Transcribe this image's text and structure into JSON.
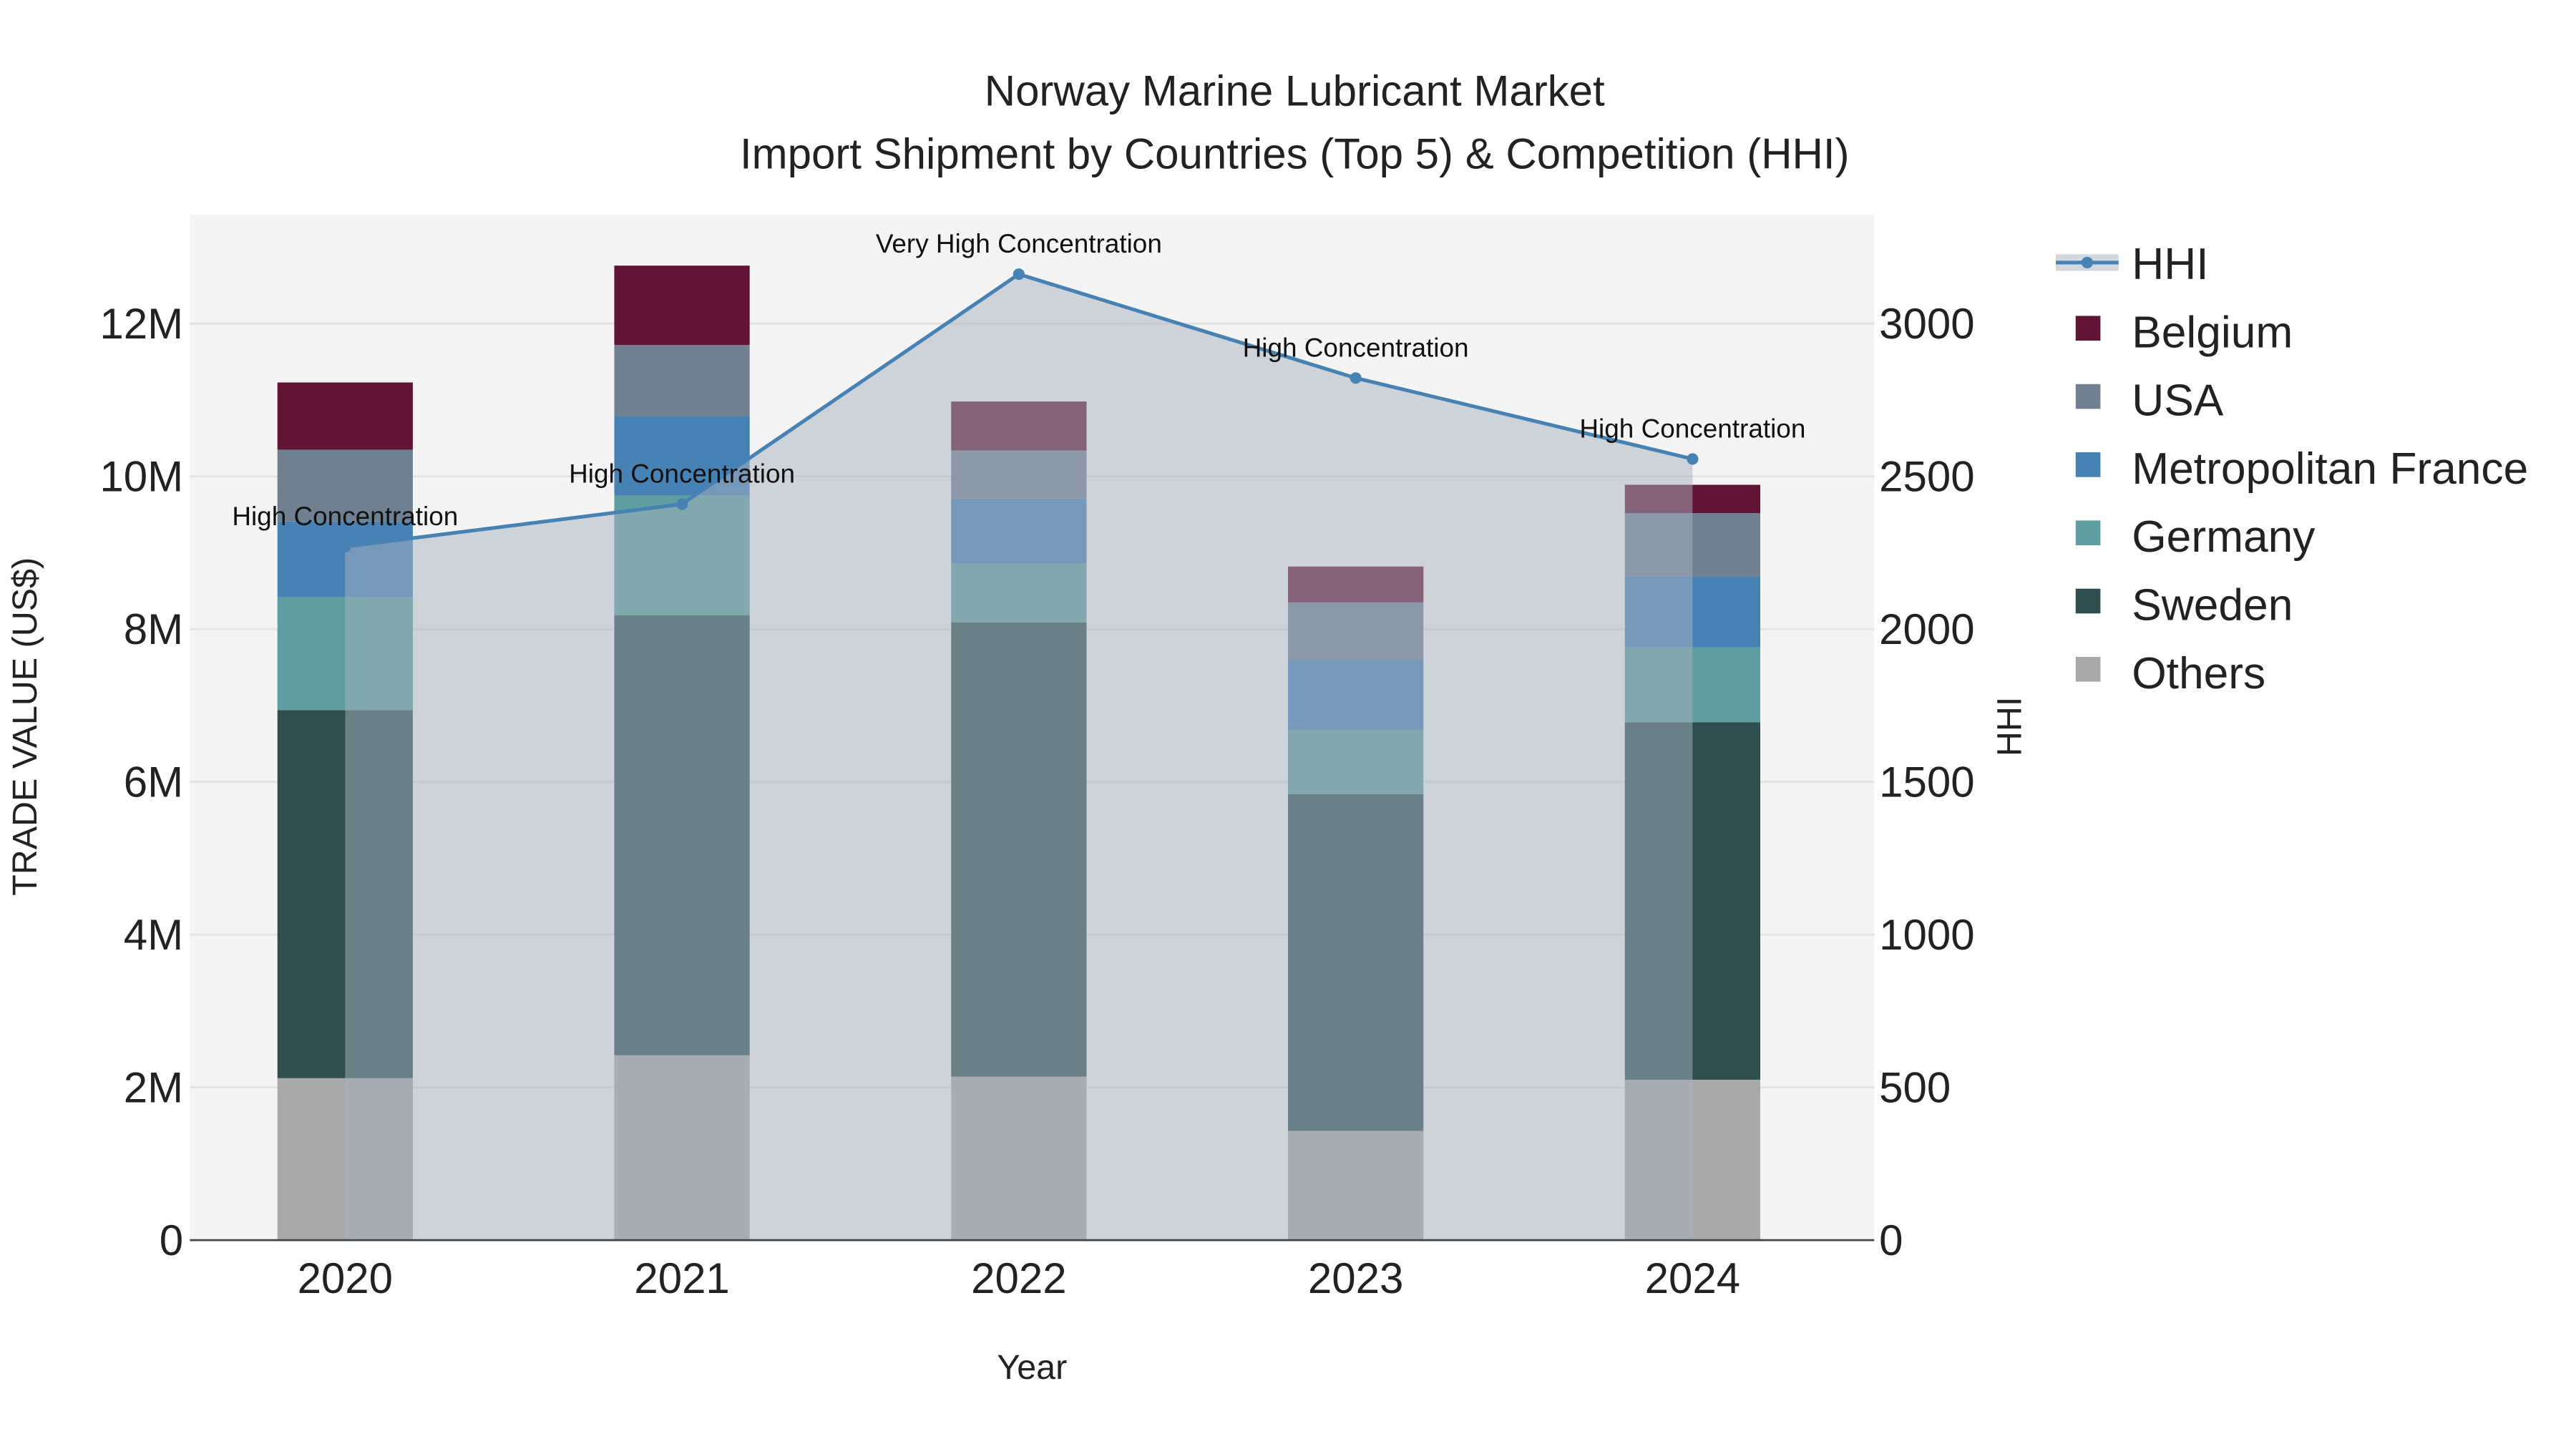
{
  "chart_data": {
    "type": "bar",
    "title": "Norway Marine Lubricant Market",
    "subtitle": "Import Shipment by Countries (Top 5) & Competition (HHI)",
    "xlabel": "Year",
    "ylabel": "TRADE VALUE (US$)",
    "y2label": "HHI",
    "categories": [
      "2020",
      "2021",
      "2022",
      "2023",
      "2024"
    ],
    "ylim": [
      0,
      13.4
    ],
    "y_unit": "M US$",
    "yticks": [
      0,
      2,
      4,
      6,
      8,
      10,
      12
    ],
    "ytick_labels": [
      "0",
      "2M",
      "4M",
      "6M",
      "8M",
      "10M",
      "12M"
    ],
    "y2lim": [
      0,
      3350
    ],
    "y2ticks": [
      0,
      500,
      1000,
      1500,
      2000,
      2500,
      3000
    ],
    "y2tick_labels": [
      "0",
      "500",
      "1000",
      "1500",
      "2000",
      "2500",
      "3000"
    ],
    "grid": true,
    "legend_position": "right",
    "series": [
      {
        "name": "Others",
        "color": "#a9a9a9",
        "values": [
          2.12,
          2.42,
          2.14,
          1.43,
          2.1
        ]
      },
      {
        "name": "Sweden",
        "color": "#2f4f4f",
        "values": [
          4.82,
          5.76,
          5.95,
          4.41,
          4.68
        ]
      },
      {
        "name": "Germany",
        "color": "#5f9ea0",
        "values": [
          1.48,
          1.57,
          0.77,
          0.84,
          0.98
        ]
      },
      {
        "name": "Metropolitan France",
        "color": "#4682b4",
        "values": [
          0.99,
          1.04,
          0.85,
          0.91,
          0.93
        ]
      },
      {
        "name": "USA",
        "color": "#708090",
        "values": [
          0.94,
          0.93,
          0.63,
          0.76,
          0.83
        ]
      },
      {
        "name": "Belgium",
        "color": "#611434",
        "values": [
          0.88,
          1.04,
          0.64,
          0.47,
          0.37
        ]
      }
    ],
    "hhi": {
      "name": "HHI",
      "color": "#4682b4",
      "values": [
        2270,
        2409,
        3162,
        2822,
        2557
      ],
      "annotations": [
        "High Concentration",
        "High Concentration",
        "Very High Concentration",
        "High Concentration",
        "High Concentration"
      ]
    },
    "legend": [
      "HHI",
      "Belgium",
      "USA",
      "Metropolitan France",
      "Germany",
      "Sweden",
      "Others"
    ]
  }
}
